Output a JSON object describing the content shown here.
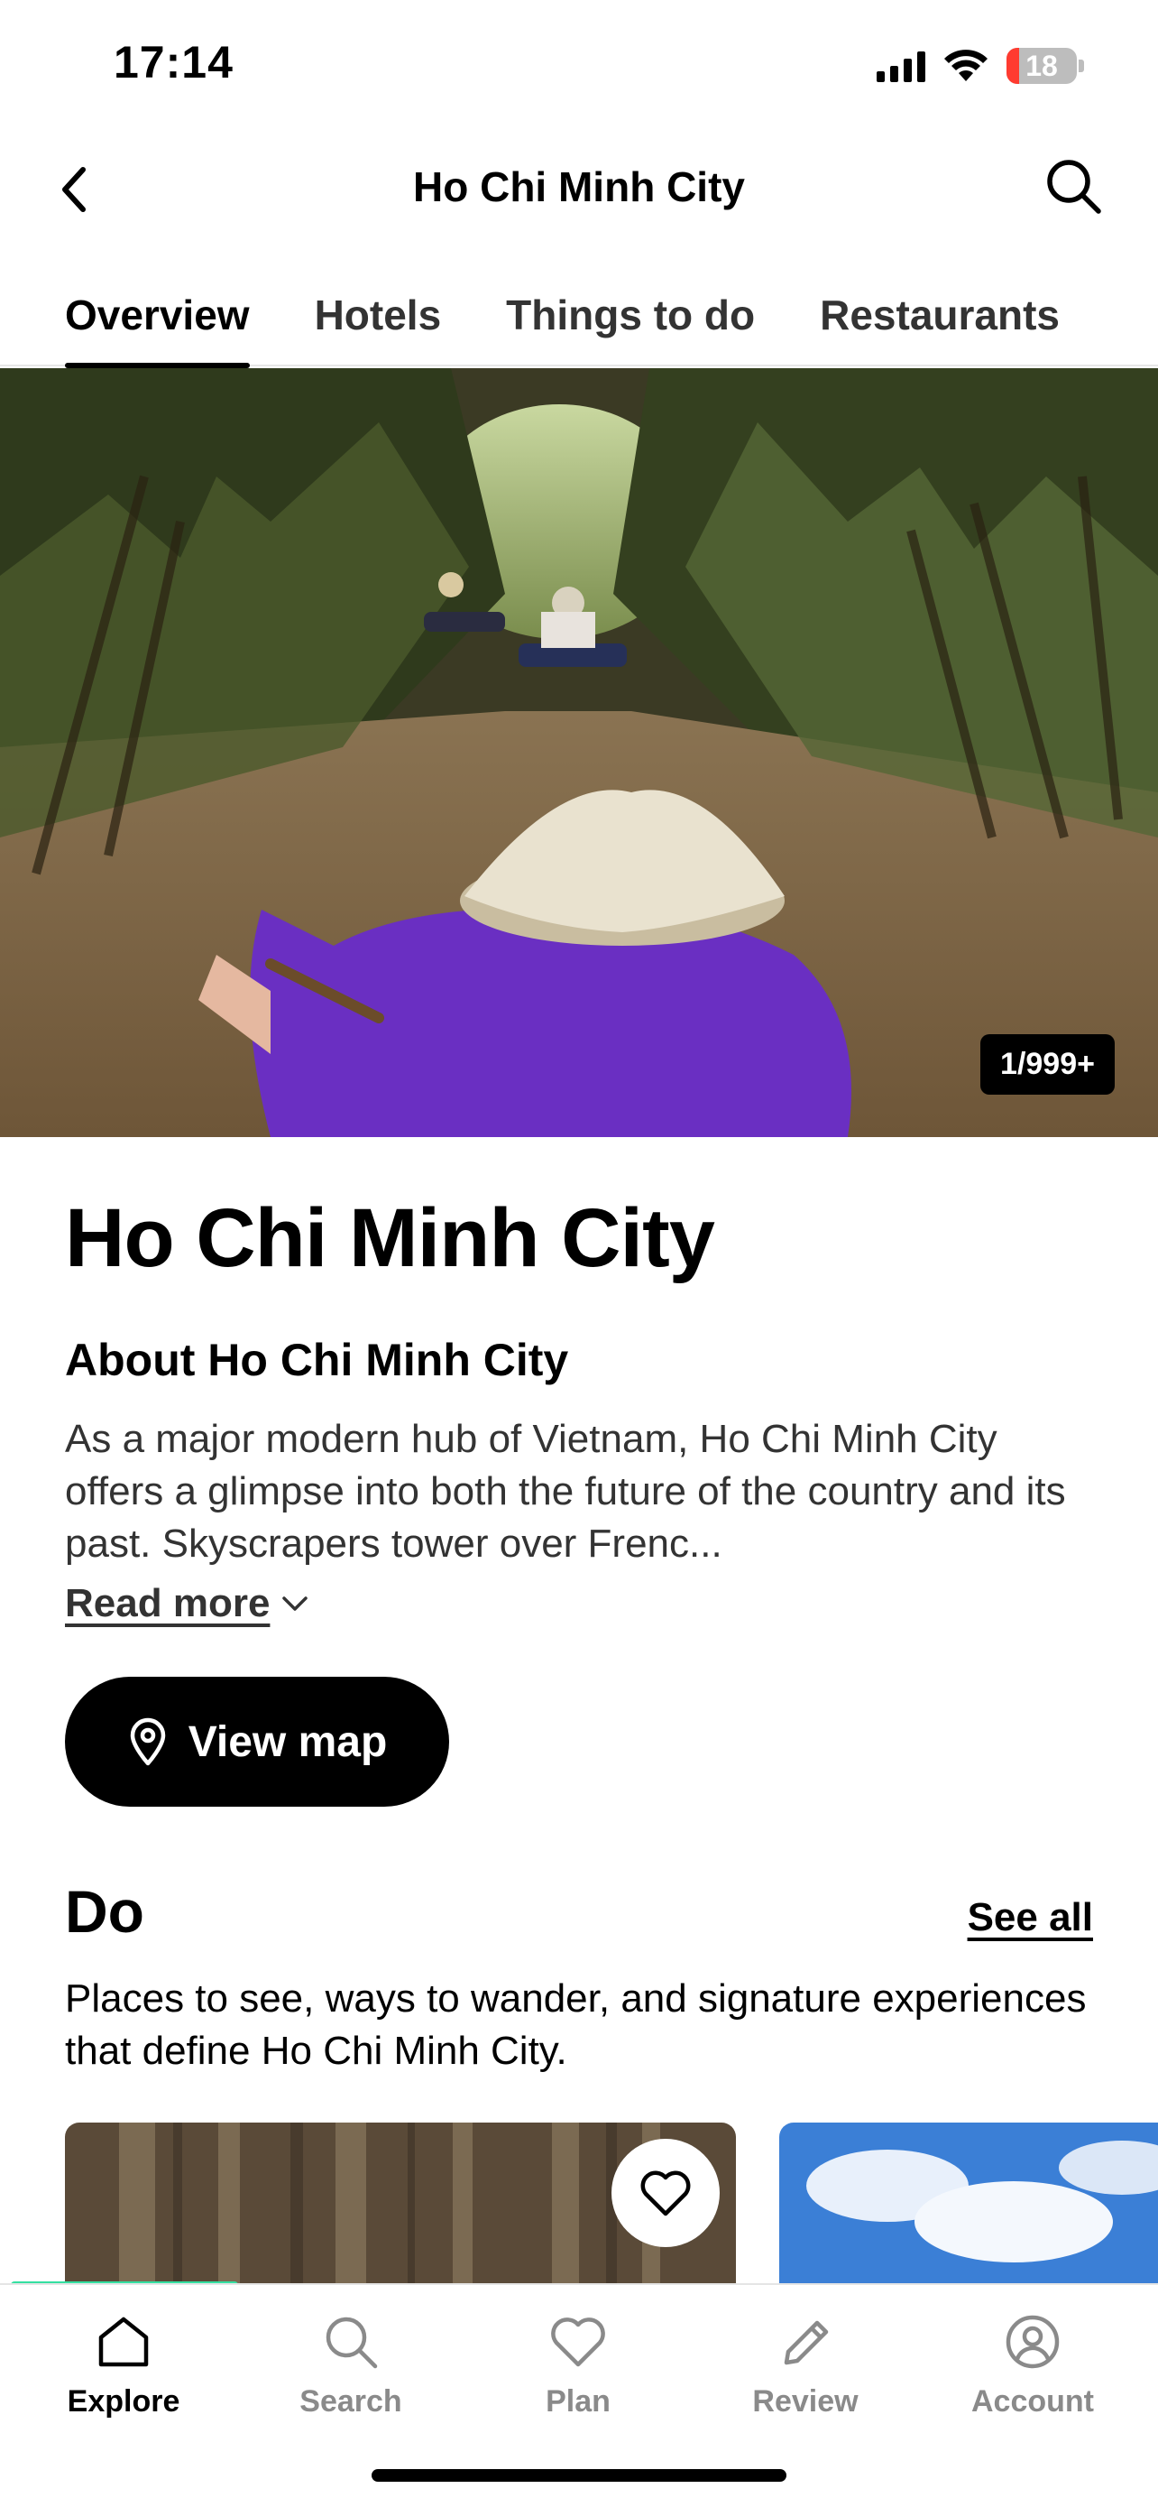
{
  "status_bar": {
    "time": "17:14",
    "battery": "18",
    "battery_level": 0.18
  },
  "header": {
    "title": "Ho Chi Minh City",
    "back_icon": "chevron-left-icon",
    "search_icon": "search-icon"
  },
  "tabs": [
    {
      "label": "Overview",
      "active": true
    },
    {
      "label": "Hotels",
      "active": false
    },
    {
      "label": "Things to do",
      "active": false
    },
    {
      "label": "Restaurants",
      "active": false
    }
  ],
  "hero": {
    "photo_counter": "1/999+"
  },
  "main": {
    "city_title": "Ho Chi Minh City",
    "about_title": "About Ho Chi Minh City",
    "about_text": "As a major modern hub of Vietnam, Ho Chi Minh City offers a glimpse into both the future of the country and its past. Skyscrapers tower over Frenc...",
    "read_more": "Read more",
    "view_map": "View map"
  },
  "do_section": {
    "title": "Do",
    "see_all": "See all",
    "description": "Places to see, ways to wander, and signature experiences that define Ho Chi Minh City."
  },
  "bottom_nav": [
    {
      "label": "Explore",
      "icon": "home-icon",
      "active": true
    },
    {
      "label": "Search",
      "icon": "search-icon",
      "active": false
    },
    {
      "label": "Plan",
      "icon": "heart-icon",
      "active": false
    },
    {
      "label": "Review",
      "icon": "pencil-icon",
      "active": false
    },
    {
      "label": "Account",
      "icon": "account-icon",
      "active": false
    }
  ],
  "colors": {
    "accent": "#34e0a1",
    "battery_low": "#ff3b30"
  }
}
